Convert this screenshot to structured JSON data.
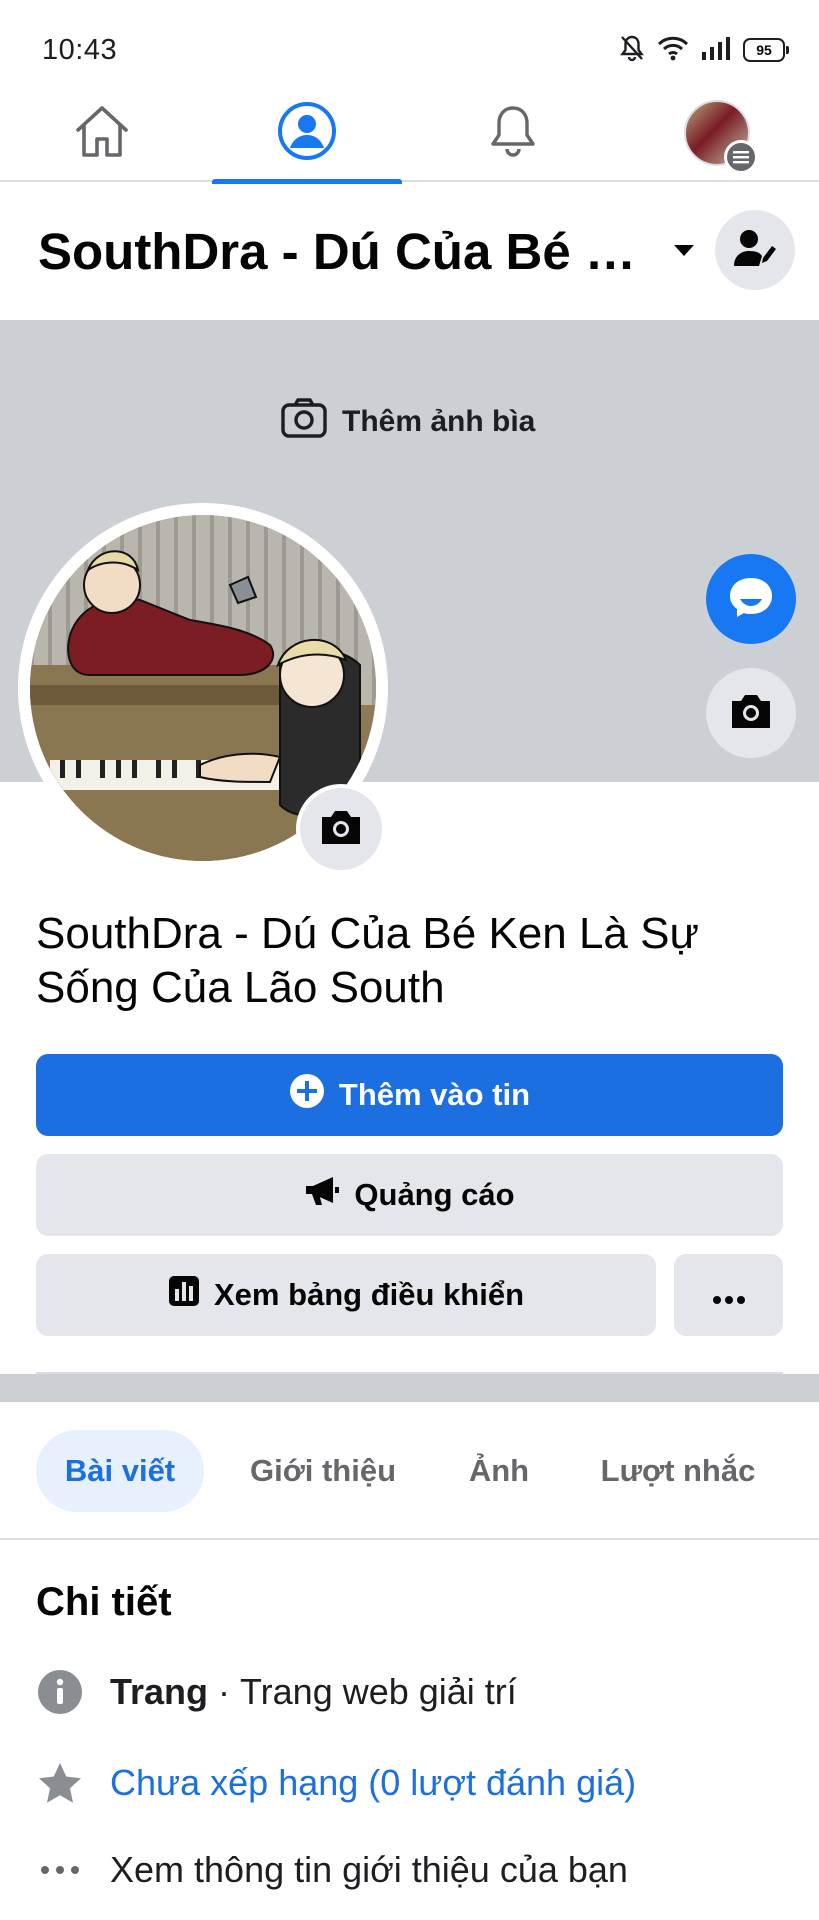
{
  "status_bar": {
    "time": "10:43",
    "battery": "95",
    "icons": [
      "mute-bell-icon",
      "wifi-icon",
      "signal-icon",
      "battery-icon"
    ]
  },
  "nav": {
    "tabs": [
      {
        "name": "home",
        "icon": "home-icon",
        "active": false
      },
      {
        "name": "profile",
        "icon": "profile-icon",
        "active": true
      },
      {
        "name": "notifications",
        "icon": "bell-icon",
        "active": false
      },
      {
        "name": "menu",
        "icon": "avatar-menu-icon",
        "active": false
      }
    ]
  },
  "header": {
    "title": "SouthDra - Dú Của Bé Ken Là Sự Sống Của Lão South"
  },
  "cover": {
    "add_cover_label": "Thêm ảnh bìa"
  },
  "page": {
    "name": "SouthDra - Dú Của Bé Ken Là Sự Sống Của Lão South"
  },
  "actions": {
    "add_to_story": "Thêm vào tin",
    "ads": "Quảng cáo",
    "dashboard": "Xem bảng điều khiển",
    "more": "···"
  },
  "tabs": [
    {
      "label": "Bài viết",
      "active": true
    },
    {
      "label": "Giới thiệu",
      "active": false
    },
    {
      "label": "Ảnh",
      "active": false
    },
    {
      "label": "Lượt nhắc",
      "active": false
    }
  ],
  "details": {
    "title": "Chi tiết",
    "page_type_label": "Trang",
    "page_type_sep": " · ",
    "page_type_value": "Trang web giải trí",
    "rating": "Chưa xếp hạng (0 lượt đánh giá)",
    "see_about": "Xem thông tin giới thiệu của bạn"
  },
  "colors": {
    "accent": "#1b6fe0",
    "button_gray": "#e4e6eb",
    "cover_gray": "#ccd0d5",
    "muted_text": "#65676b"
  }
}
